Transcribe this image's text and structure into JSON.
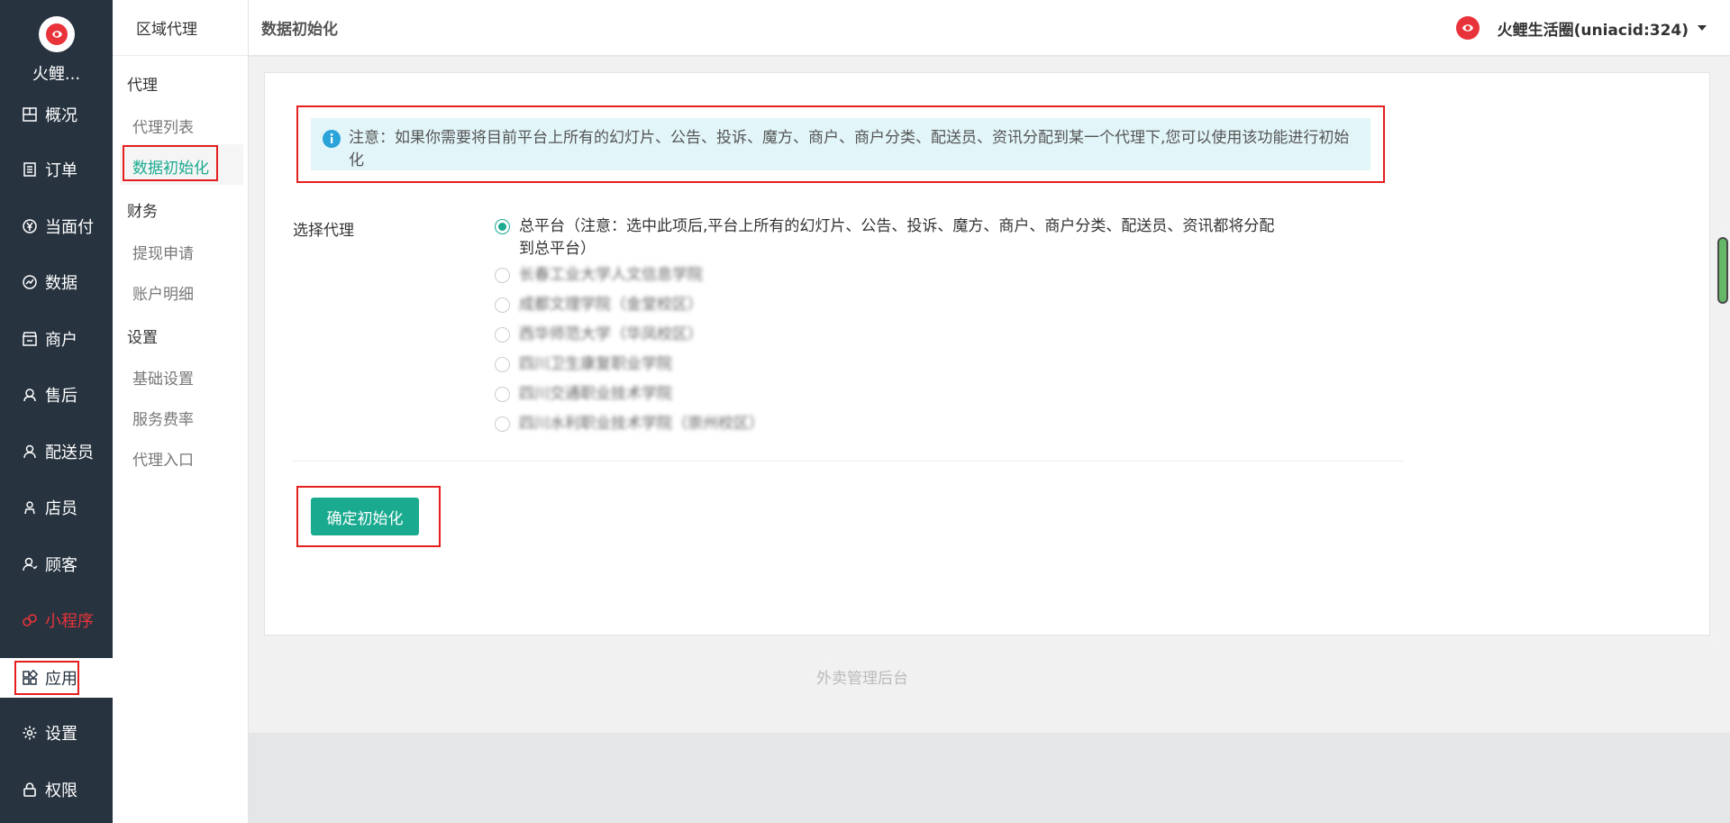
{
  "brand": {
    "name": "火鲤..."
  },
  "leftnav": [
    {
      "label": "概况",
      "icon": "overview-icon"
    },
    {
      "label": "订单",
      "icon": "order-icon"
    },
    {
      "label": "当面付",
      "icon": "yuan-icon"
    },
    {
      "label": "数据",
      "icon": "chart-icon"
    },
    {
      "label": "商户",
      "icon": "store-icon"
    },
    {
      "label": "售后",
      "icon": "aftersale-icon"
    },
    {
      "label": "配送员",
      "icon": "courier-icon"
    },
    {
      "label": "店员",
      "icon": "clerk-icon"
    },
    {
      "label": "顾客",
      "icon": "customer-icon"
    },
    {
      "label": "小程序",
      "icon": "miniprogram-icon"
    },
    {
      "label": "应用",
      "icon": "apps-icon"
    },
    {
      "label": "设置",
      "icon": "gear-icon"
    },
    {
      "label": "权限",
      "icon": "lock-icon"
    }
  ],
  "subnav": {
    "header": "区域代理",
    "groups": [
      {
        "title": "代理",
        "items": [
          "代理列表",
          "数据初始化"
        ]
      },
      {
        "title": "财务",
        "items": [
          "提现申请",
          "账户明细"
        ]
      },
      {
        "title": "设置",
        "items": [
          "基础设置",
          "服务费率",
          "代理入口"
        ]
      }
    ]
  },
  "header": {
    "page_title": "数据初始化",
    "account": "火鲤生活圈(uniacid:324)"
  },
  "main": {
    "notice": "注意：如果你需要将目前平台上所有的幻灯片、公告、投诉、魔方、商户、商户分类、配送员、资讯分配到某一个代理下,您可以使用该功能进行初始化",
    "select_label": "选择代理",
    "options": [
      {
        "label": "总平台（注意：选中此项后,平台上所有的幻灯片、公告、投诉、魔方、商户、商户分类、配送员、资讯都将分配到总平台）",
        "checked": true
      },
      {
        "label": "长春工业大学人文信息学院",
        "checked": false
      },
      {
        "label": "成都文理学院（金堂校区）",
        "checked": false
      },
      {
        "label": "西华师范大学（华凤校区）",
        "checked": false
      },
      {
        "label": "四川卫生康复职业学院",
        "checked": false
      },
      {
        "label": "四川交通职业技术学院",
        "checked": false
      },
      {
        "label": "四川水利职业技术学院（崇州校区）",
        "checked": false
      }
    ],
    "confirm_button": "确定初始化",
    "footer": "外卖管理后台"
  },
  "colors": {
    "sidebar": "#273440",
    "accent": "#1aaa8f",
    "highlight": "#e61e1e",
    "brand_red": "#e8333a"
  }
}
